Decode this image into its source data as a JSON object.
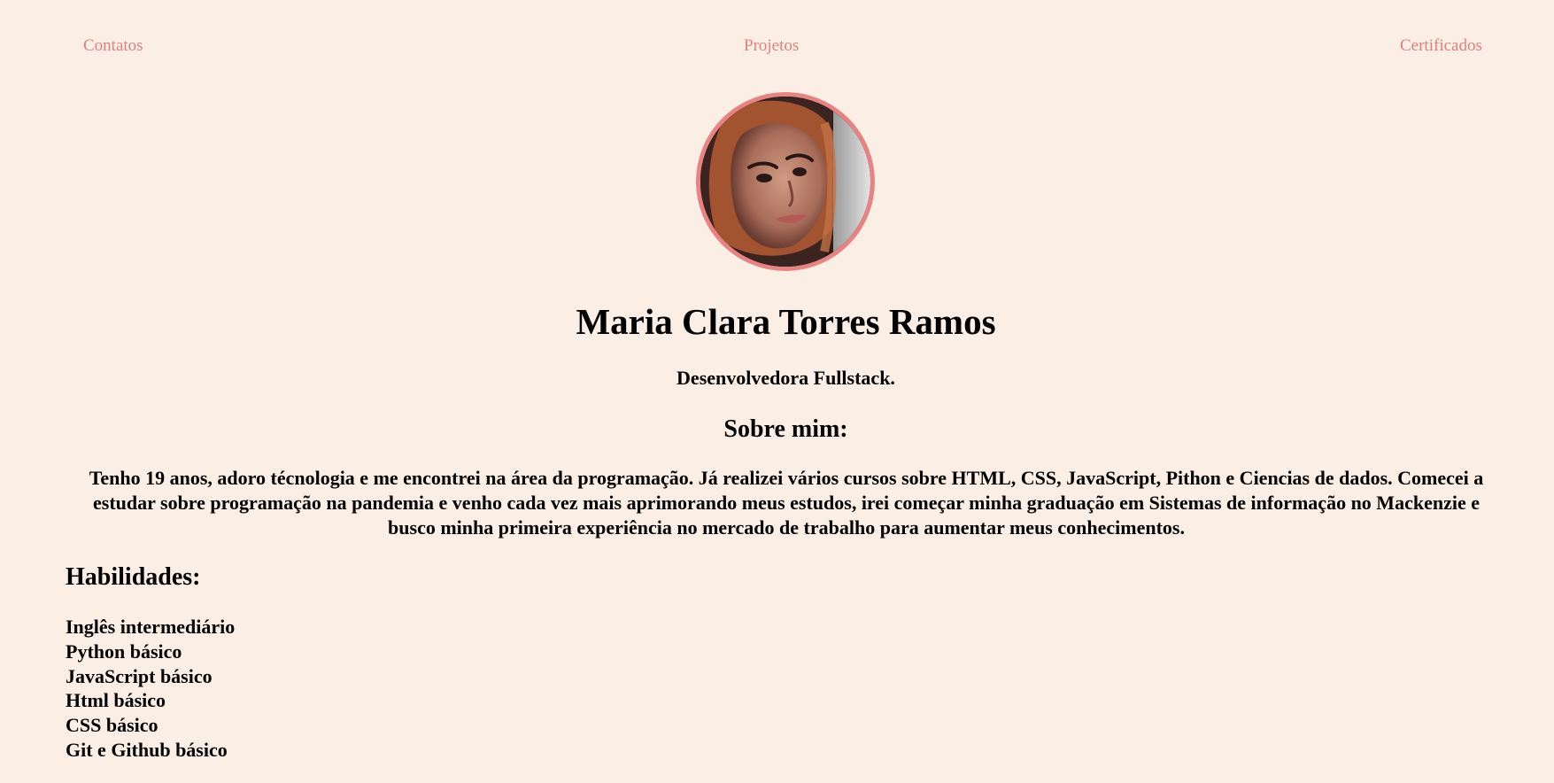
{
  "nav": {
    "contatos": "Contatos",
    "projetos": "Projetos",
    "certificados": "Certificados",
    "link_color": "#e07f7f"
  },
  "profile": {
    "name": "Maria Clara Torres Ramos",
    "role": "Desenvolvedora Fullstack.",
    "avatar_border_color": "#e98282"
  },
  "about": {
    "title": "Sobre mim:",
    "text": "Tenho 19 anos, adoro técnologia e me encontrei na área da programação. Já realizei vários cursos sobre HTML, CSS, JavaScript, Pithon e Ciencias de dados. Comecei a estudar sobre programação na pandemia e venho cada vez mais aprimorando meus estudos, irei começar minha graduação em Sistemas de informação no Mackenzie e busco minha primeira experiência no mercado de trabalho para aumentar meus conhecimentos."
  },
  "skills": {
    "title": "Habilidades:",
    "items": [
      "Inglês intermediário",
      "Python básico",
      "JavaScript básico",
      "Html básico",
      "CSS básico",
      "Git e Github básico"
    ]
  },
  "theme": {
    "background": "#fbefe5"
  }
}
